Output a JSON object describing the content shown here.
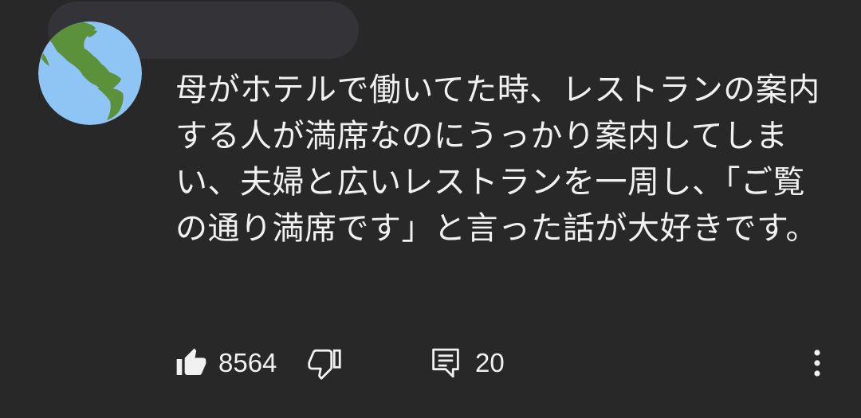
{
  "comment": {
    "avatar_icon": "globe-americas-icon",
    "author_redacted": true,
    "text": "母がホテルで働いてた時、レストランの案内する人が満席なのにうっかり案内してしまい、夫婦と広いレストランを一周し、「ご覧の通り満席です」と言った話が大好きです。"
  },
  "actions": {
    "like_icon": "thumbs-up-icon",
    "like_count": "8564",
    "dislike_icon": "thumbs-down-icon",
    "reply_icon": "comment-icon",
    "reply_count": "20",
    "more_icon": "more-vertical-icon"
  },
  "colors": {
    "background": "#282828",
    "text": "#f1f1f1",
    "globe_ocean": "#8fc5f4",
    "globe_land": "#5c913b"
  }
}
